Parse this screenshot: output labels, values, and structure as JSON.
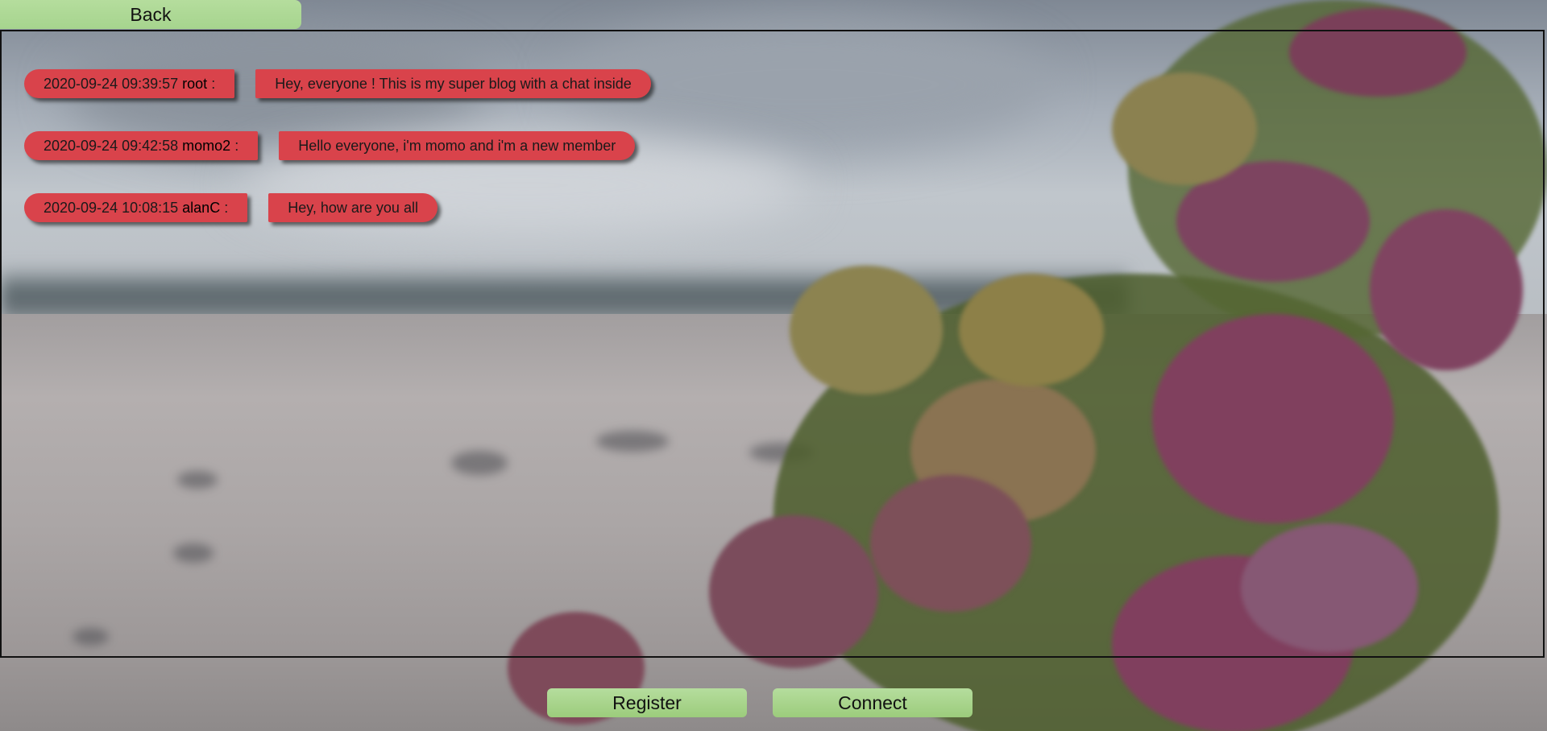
{
  "nav": {
    "back_label": "Back"
  },
  "messages": [
    {
      "timestamp": "2020-09-24 09:39:57",
      "author": "root",
      "separator": ":",
      "text": "Hey, everyone ! This is my super blog with a chat inside"
    },
    {
      "timestamp": "2020-09-24 09:42:58",
      "author": "momo2",
      "separator": ":",
      "text": "Hello everyone, i'm momo and i'm a new member"
    },
    {
      "timestamp": "2020-09-24 10:08:15",
      "author": "alanC",
      "separator": ":",
      "text": "Hey, how are you all"
    }
  ],
  "actions": {
    "register_label": "Register",
    "connect_label": "Connect"
  },
  "colors": {
    "message_bubble": "#d9434b",
    "button_green": "#a6d48e",
    "frame_border": "#111111"
  }
}
